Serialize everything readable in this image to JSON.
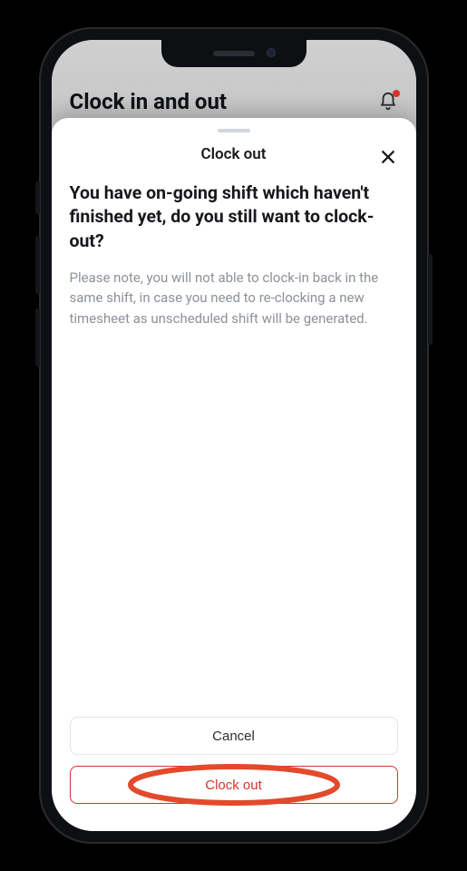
{
  "background": {
    "screen_title": "Clock in and out"
  },
  "sheet": {
    "title": "Clock out",
    "heading": "You have on-going shift which haven't finished yet, do you still want to clock-out?",
    "body": "Please note, you will not able to clock-in back in the same shift, in case you need to re-clocking a new timesheet as unscheduled shift will be generated.",
    "cancel_label": "Cancel",
    "confirm_label": "Clock out"
  },
  "colors": {
    "accent": "#d6332a"
  }
}
